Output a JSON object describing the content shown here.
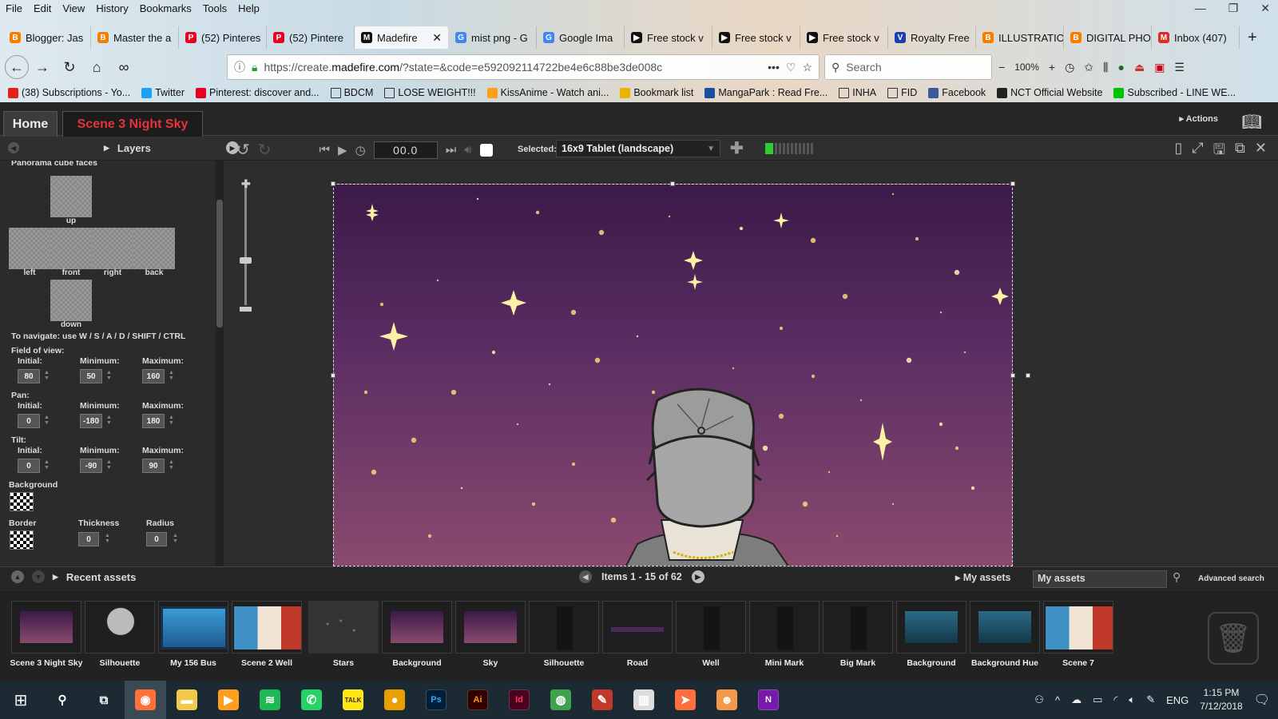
{
  "browser": {
    "menu": [
      "File",
      "Edit",
      "View",
      "History",
      "Bookmarks",
      "Tools",
      "Help"
    ],
    "tabs": [
      {
        "label": "Blogger: Jas",
        "icon": "blogger-icon",
        "color": "#f57d00",
        "active": false
      },
      {
        "label": "Master the a",
        "icon": "blogger-icon",
        "color": "#f57d00",
        "active": false
      },
      {
        "label": "(52) Pinteres",
        "icon": "pinterest-icon",
        "color": "#e60023",
        "active": false
      },
      {
        "label": "(52) Pintere",
        "icon": "pinterest-icon",
        "color": "#e60023",
        "active": false
      },
      {
        "label": "Madefire",
        "icon": "madefire-icon",
        "color": "#111111",
        "active": true
      },
      {
        "label": "mist png - G",
        "icon": "google-icon",
        "color": "#4285f4",
        "active": false
      },
      {
        "label": "Google Ima",
        "icon": "google-icon",
        "color": "#4285f4",
        "active": false
      },
      {
        "label": "Free stock v",
        "icon": "video-icon",
        "color": "#111111",
        "active": false
      },
      {
        "label": "Free stock v",
        "icon": "video-icon",
        "color": "#111111",
        "active": false
      },
      {
        "label": "Free stock v",
        "icon": "video-icon",
        "color": "#111111",
        "active": false
      },
      {
        "label": "Royalty Free",
        "icon": "v-icon",
        "color": "#1a3fb0",
        "active": false
      },
      {
        "label": "ILLUSTRATIO",
        "icon": "blogger-icon",
        "color": "#f57d00",
        "active": false
      },
      {
        "label": "DIGITAL PHO",
        "icon": "blogger-icon",
        "color": "#f57d00",
        "active": false
      },
      {
        "label": "Inbox (407)",
        "icon": "gmail-icon",
        "color": "#d93025",
        "active": false
      }
    ],
    "url_prefix": "https://create.",
    "url_domain": "madefire.com",
    "url_rest": "/?state=&code=e592092114722be4e6c88be3de008c",
    "search_placeholder": "Search",
    "zoom": "100%",
    "bookmarks": [
      {
        "label": "(38) Subscriptions - Yo...",
        "color": "#e62117"
      },
      {
        "label": "Twitter",
        "color": "#1da1f2"
      },
      {
        "label": "Pinterest: discover and...",
        "color": "#e60023"
      },
      {
        "label": "BDCM",
        "color": "folder"
      },
      {
        "label": "LOSE WEIGHT!!!",
        "color": "folder"
      },
      {
        "label": "KissAnime - Watch ani...",
        "color": "#ff9f1c"
      },
      {
        "label": "Bookmark list",
        "color": "#e8b400"
      },
      {
        "label": "MangaPark : Read Fre...",
        "color": "#1a4fa0"
      },
      {
        "label": "INHA",
        "color": "folder"
      },
      {
        "label": "FID",
        "color": "folder"
      },
      {
        "label": "Facebook",
        "color": "#3b5998"
      },
      {
        "label": "NCT Official Website",
        "color": "#222222"
      },
      {
        "label": "Subscribed - LINE WE...",
        "color": "#00c300"
      }
    ]
  },
  "app": {
    "home_tab": "Home",
    "scene_tab": "Scene 3 Night Sky",
    "actions": "Actions",
    "layers": "Layers",
    "timecode": "00.0",
    "selected_label": "Selected:",
    "device": "16x9 Tablet (landscape)"
  },
  "panel": {
    "title": "Panorama cube faces",
    "faces": {
      "up": "up",
      "left": "left",
      "front": "front",
      "right": "right",
      "back": "back",
      "down": "down"
    },
    "nav_hint": "To navigate: use W / S / A / D / SHIFT / CTRL",
    "fov_label": "Field of view:",
    "pan_label": "Pan:",
    "tilt_label": "Tilt:",
    "initial": "Initial:",
    "minimum": "Minimum:",
    "maximum": "Maximum:",
    "fov": {
      "initial": "80",
      "minimum": "50",
      "maximum": "160"
    },
    "pan": {
      "initial": "0",
      "minimum": "-180",
      "maximum": "180"
    },
    "tilt": {
      "initial": "0",
      "minimum": "-90",
      "maximum": "90"
    },
    "background_label": "Background",
    "border_label": "Border",
    "thickness_label": "Thickness",
    "radius_label": "Radius",
    "thickness": "0",
    "radius": "0"
  },
  "assets": {
    "recent_label": "Recent assets",
    "pager": "Items 1 - 15 of 62",
    "my_assets_button": "My assets",
    "my_assets_field": "My assets",
    "advanced_search": "Advanced search",
    "items": [
      {
        "name": "Scene 3 Night Sky",
        "kind": "sky"
      },
      {
        "name": "Silhouette",
        "kind": "boy"
      },
      {
        "name": "My 156 Bus",
        "kind": "bus"
      },
      {
        "name": "Scene 2 Well",
        "kind": "scene"
      },
      {
        "name": "Stars",
        "kind": "stars",
        "selected": true
      },
      {
        "name": "Background",
        "kind": "sky"
      },
      {
        "name": "Sky",
        "kind": "sky"
      },
      {
        "name": "Silhouette",
        "kind": "dark"
      },
      {
        "name": "Road",
        "kind": "road"
      },
      {
        "name": "Well",
        "kind": "dark"
      },
      {
        "name": "Mini Mark",
        "kind": "dark"
      },
      {
        "name": "Big Mark",
        "kind": "dark"
      },
      {
        "name": "Background",
        "kind": "teal"
      },
      {
        "name": "Background Hue",
        "kind": "teal"
      },
      {
        "name": "Scene 7",
        "kind": "scene"
      }
    ]
  },
  "taskbar": {
    "time": "1:15 PM",
    "date": "7/12/2018",
    "lang": "ENG",
    "apps": [
      {
        "icon": "search-icon",
        "label": "",
        "color": "transparent"
      },
      {
        "icon": "taskview-icon",
        "label": "",
        "color": "transparent"
      },
      {
        "icon": "firefox-icon",
        "label": "",
        "color": "#ff7139"
      },
      {
        "icon": "folder-icon",
        "label": "",
        "color": "#f2c94c"
      },
      {
        "icon": "media-icon",
        "label": "",
        "color": "#ff9f1c"
      },
      {
        "icon": "spotify-icon",
        "label": "",
        "color": "#1db954"
      },
      {
        "icon": "whatsapp-icon",
        "label": "",
        "color": "#25d366"
      },
      {
        "icon": "kakaotalk-icon",
        "label": "TALK",
        "color": "#ffe812"
      },
      {
        "icon": "app-icon",
        "label": "",
        "color": "#e8a000"
      },
      {
        "icon": "photoshop-icon",
        "label": "Ps",
        "color": "#001e36"
      },
      {
        "icon": "illustrator-icon",
        "label": "Ai",
        "color": "#330000"
      },
      {
        "icon": "indesign-icon",
        "label": "Id",
        "color": "#49021f"
      },
      {
        "icon": "globe-icon",
        "label": "",
        "color": "#3fa34d"
      },
      {
        "icon": "pencil-icon",
        "label": "",
        "color": "#c0392b"
      },
      {
        "icon": "piano-icon",
        "label": "",
        "color": "#dddddd"
      },
      {
        "icon": "fish-icon",
        "label": "",
        "color": "#ff6f3c"
      },
      {
        "icon": "character-icon",
        "label": "",
        "color": "#f2994a"
      },
      {
        "icon": "onenote-icon",
        "label": "N",
        "color": "#7719aa"
      }
    ]
  }
}
